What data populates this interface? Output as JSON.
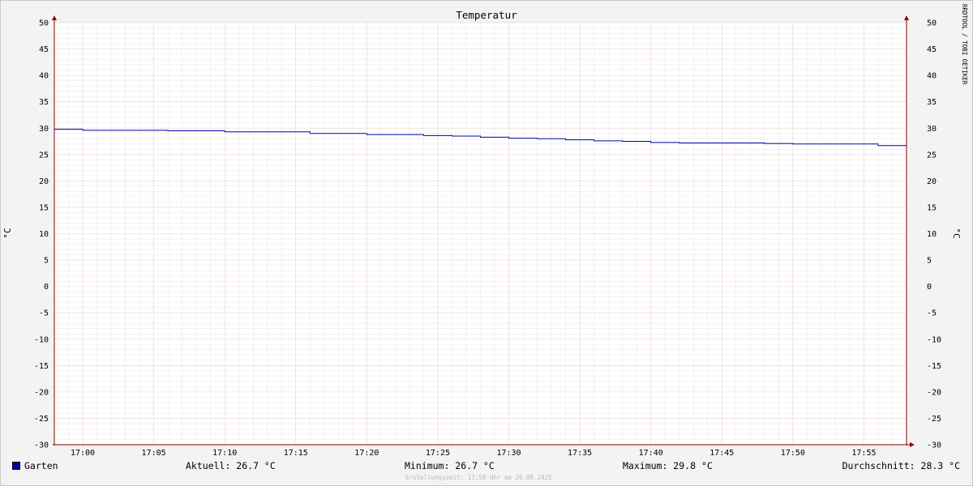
{
  "chart_data": {
    "type": "line",
    "title": "Temperatur",
    "ylabel": "°C",
    "ylim": [
      -30,
      50
    ],
    "y_ticks": [
      50,
      45,
      40,
      35,
      30,
      25,
      20,
      15,
      10,
      5,
      0,
      -5,
      -10,
      -15,
      -20,
      -25,
      -30
    ],
    "x_ticks": [
      "17:00",
      "17:05",
      "17:10",
      "17:15",
      "17:20",
      "17:25",
      "17:30",
      "17:35",
      "17:40",
      "17:45",
      "17:50",
      "17:55"
    ],
    "x_range": [
      "16:58",
      "17:58"
    ],
    "grid": true,
    "legend_position": "bottom-left",
    "series": [
      {
        "name": "Garten",
        "color": "#0000a8",
        "points": [
          [
            "16:58",
            29.8
          ],
          [
            "17:00",
            29.6
          ],
          [
            "17:06",
            29.5
          ],
          [
            "17:10",
            29.3
          ],
          [
            "17:16",
            29.0
          ],
          [
            "17:20",
            28.8
          ],
          [
            "17:24",
            28.6
          ],
          [
            "17:26",
            28.5
          ],
          [
            "17:28",
            28.3
          ],
          [
            "17:30",
            28.1
          ],
          [
            "17:32",
            28.0
          ],
          [
            "17:34",
            27.8
          ],
          [
            "17:36",
            27.6
          ],
          [
            "17:38",
            27.5
          ],
          [
            "17:40",
            27.3
          ],
          [
            "17:42",
            27.2
          ],
          [
            "17:48",
            27.1
          ],
          [
            "17:50",
            27.0
          ],
          [
            "17:56",
            26.7
          ],
          [
            "17:58",
            26.7
          ]
        ]
      }
    ]
  },
  "legend": {
    "series_label": "Garten",
    "series_color": "#0000a8",
    "current": "Aktuell: 26.7 °C",
    "minimum": "Minimum: 26.7 °C",
    "maximum": "Maximum: 29.8 °C",
    "average": "Durchschnitt: 28.3 °C"
  },
  "credit": "Erstellungszeit: 17:58 Uhr am 26.08.2025",
  "watermark": "RRDTOOL / TOBI OETIKER",
  "colors": {
    "background": "#f3f3f3",
    "plot_background": "#ffffff",
    "minor_grid": "#d2d2d2",
    "major_grid": "#e2a0a0",
    "axis": "#8b0000"
  }
}
